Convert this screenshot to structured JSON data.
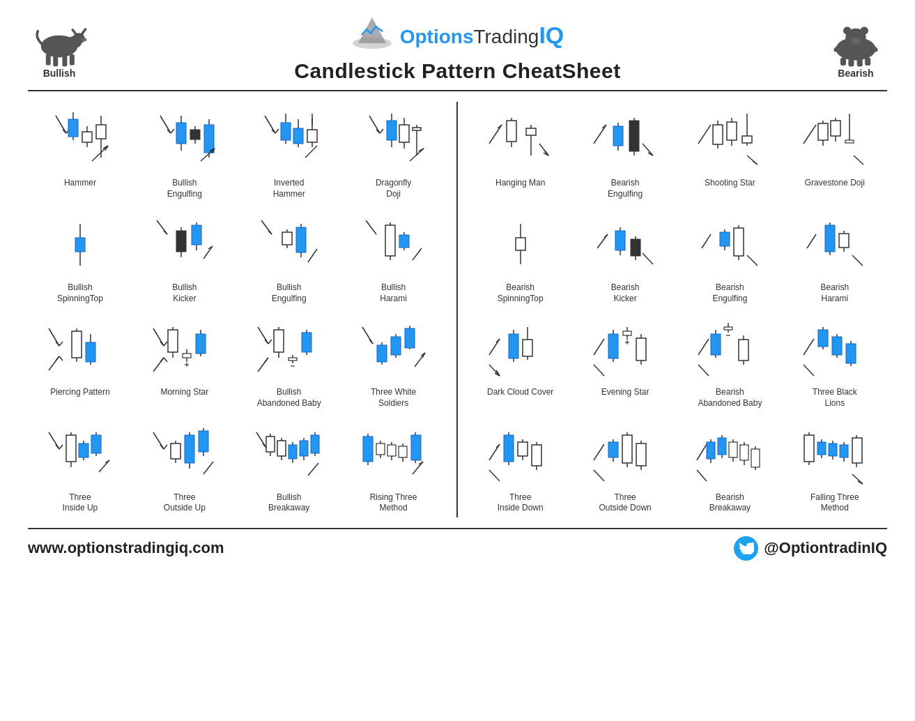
{
  "header": {
    "title": "Candlestick Pattern CheatSheet",
    "logo_brand": "Options",
    "logo_trading": "Trading",
    "logo_iq": "IQ",
    "bullish_label": "Bullish",
    "bearish_label": "Bearish"
  },
  "footer": {
    "website": "www.optionstradingiq.com",
    "twitter": "@OptiontradinIQ"
  },
  "bullish_patterns": [
    {
      "name": "Hammer"
    },
    {
      "name": "Bullish Engulfing"
    },
    {
      "name": "Inverted Hammer"
    },
    {
      "name": "Dragonfly Doji"
    },
    {
      "name": "Bullish SpinningTop"
    },
    {
      "name": "Bullish Kicker"
    },
    {
      "name": "Bullish Engulfing"
    },
    {
      "name": "Bullish Harami"
    },
    {
      "name": "Piercing Pattern"
    },
    {
      "name": "Morning Star"
    },
    {
      "name": "Bullish Abandoned Baby"
    },
    {
      "name": "Three White Soldiers"
    },
    {
      "name": "Three Inside Up"
    },
    {
      "name": "Three Outside Up"
    },
    {
      "name": "Bullish Breakaway"
    },
    {
      "name": "Rising Three Method"
    }
  ],
  "bearish_patterns": [
    {
      "name": "Hanging Man"
    },
    {
      "name": "Bearish Engulfing"
    },
    {
      "name": "Shooting Star"
    },
    {
      "name": "Gravestone Doji"
    },
    {
      "name": "Bearish SpinningTop"
    },
    {
      "name": "Bearish Kicker"
    },
    {
      "name": "Bearish Engulfing"
    },
    {
      "name": "Bearish Harami"
    },
    {
      "name": "Dark Cloud Cover"
    },
    {
      "name": "Evening Star"
    },
    {
      "name": "Bearish Abandoned Baby"
    },
    {
      "name": "Three Black Lions"
    },
    {
      "name": "Three Inside Down"
    },
    {
      "name": "Three Outside Down"
    },
    {
      "name": "Bearish Breakaway"
    },
    {
      "name": "Falling Three Method"
    }
  ]
}
